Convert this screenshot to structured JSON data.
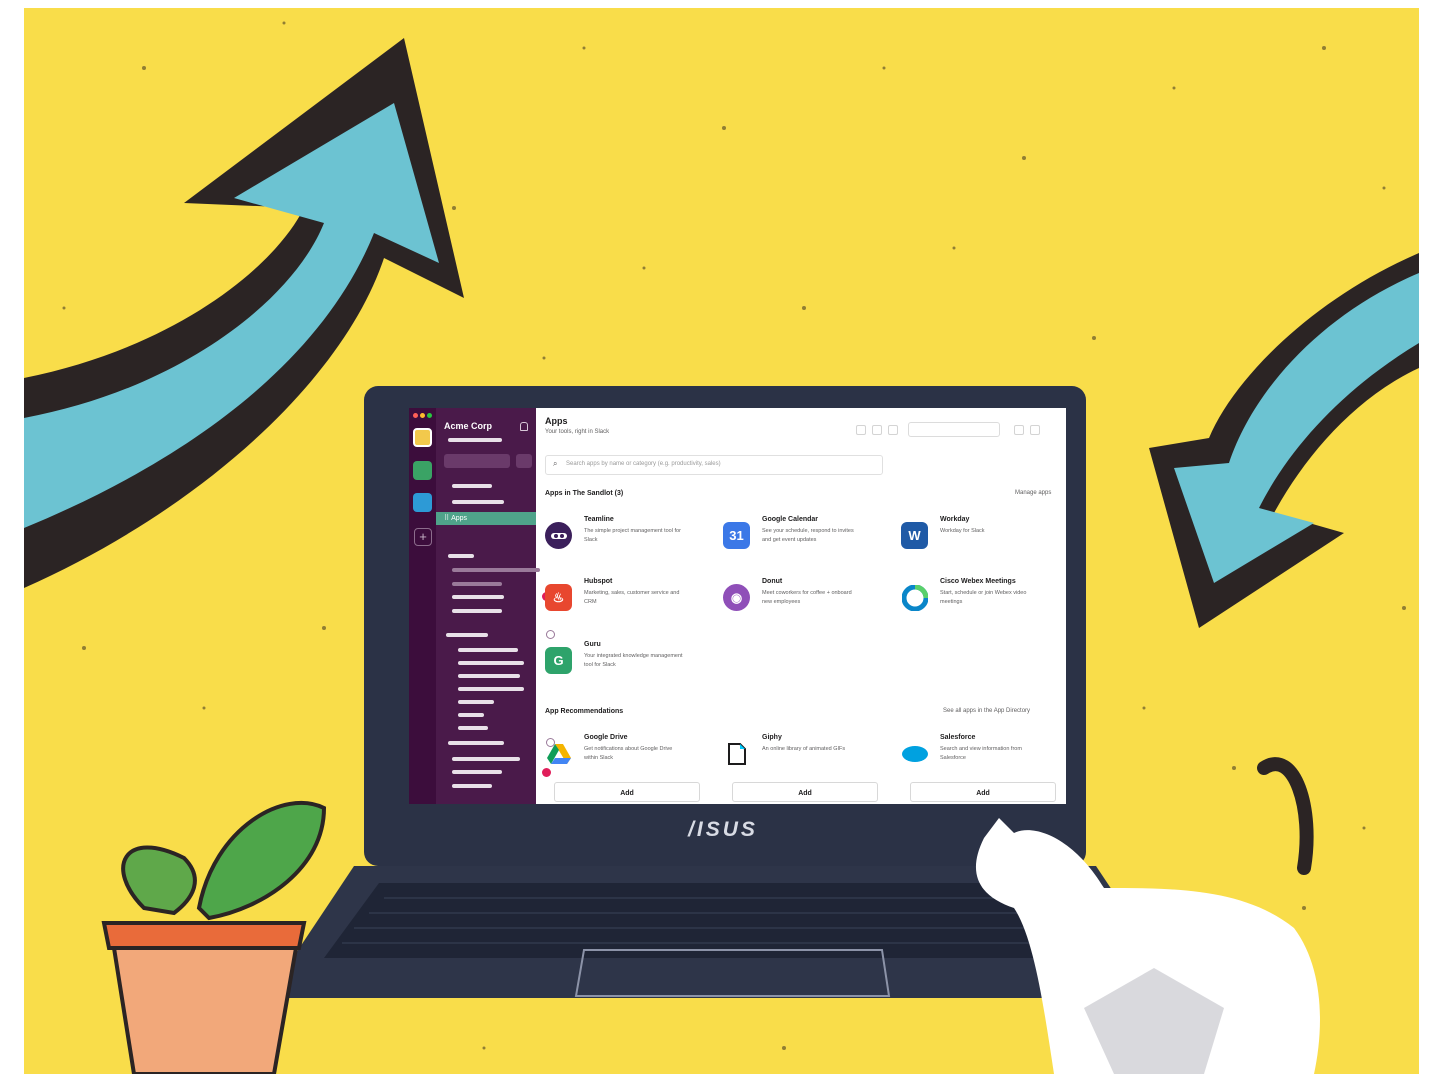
{
  "colors": {
    "poster_bg": "#f9dd4a",
    "arrow_fill": "#6cc3d2",
    "arrow_outline": "#2b2424",
    "laptop_body": "#2b3246",
    "slack_sidebar": "#4a1a4a",
    "slack_rail": "#3c0d3c",
    "active_item": "#4fa38a",
    "badge": "#e01e5a"
  },
  "laptop": {
    "brand": "/ISUS"
  },
  "sidebar": {
    "team_name": "Acme Corp",
    "active_item_label": "⠿ Apps",
    "workspace_colors": [
      "#f2c94c",
      "#3aa365",
      "#2d9ad6"
    ]
  },
  "main": {
    "title": "Apps",
    "subtitle": "Your tools, right in Slack",
    "search_placeholder": "Search apps by name or category (e.g. productivity, sales)",
    "installed_title": "Apps in The Sandlot (3)",
    "manage_link": "Manage apps",
    "installed": [
      {
        "name": "Teamline",
        "desc": "The simple project management tool for Slack",
        "logo_text": "",
        "icon": "teamline-icon",
        "color": "#3b1f5b"
      },
      {
        "name": "Google Calendar",
        "desc": "See your schedule, respond to invites and get event updates",
        "logo_text": "31",
        "icon": "calendar-icon",
        "color": "#3b78e7"
      },
      {
        "name": "Workday",
        "desc": "Workday for Slack",
        "logo_text": "W",
        "icon": "workday-icon",
        "color": "#1f5aa6"
      },
      {
        "name": "Hubspot",
        "desc": "Marketing, sales, customer service and CRM",
        "logo_text": "♨",
        "icon": "hubspot-icon",
        "color": "#e8472f"
      },
      {
        "name": "Donut",
        "desc": "Meet coworkers for coffee + onboard new employees",
        "logo_text": "◉",
        "icon": "donut-icon",
        "color": "#8f4fb8"
      },
      {
        "name": "Cisco Webex Meetings",
        "desc": "Start, schedule or join Webex video meetings",
        "logo_text": "",
        "icon": "webex-icon",
        "color": "#0a86c9"
      },
      {
        "name": "Guru",
        "desc": "Your integrated knowledge management tool for Slack",
        "logo_text": "G",
        "icon": "guru-icon",
        "color": "#2ea36b"
      }
    ],
    "recommend_title": "App Recommendations",
    "see_all_link": "See all apps in the App Directory",
    "recommended": [
      {
        "name": "Google Drive",
        "desc": "Get notifications about Google Drive within Slack",
        "icon": "google-drive-icon",
        "add_label": "Add"
      },
      {
        "name": "Giphy",
        "desc": "An online library of animated GIFs",
        "icon": "giphy-icon",
        "add_label": "Add"
      },
      {
        "name": "Salesforce",
        "desc": "Search and view information from Salesforce",
        "icon": "salesforce-icon",
        "add_label": "Add"
      }
    ]
  }
}
